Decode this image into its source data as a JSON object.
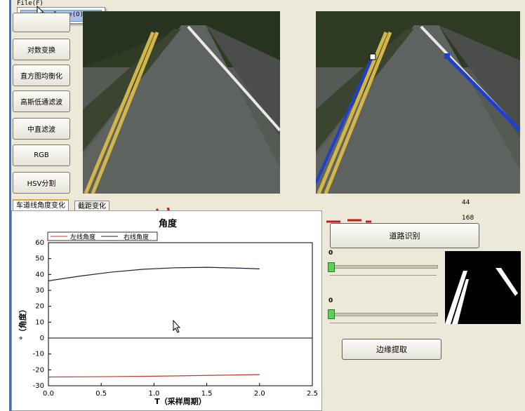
{
  "menu": {
    "file": "File(F)",
    "open_image": "OpenImage(O)"
  },
  "left_buttons": [
    "对数变换",
    "直方图均衡化",
    "高斯低通滤波",
    "中直滤波",
    "RGB",
    "HSV分割"
  ],
  "tabs": [
    "车道线角度变化",
    "截距变化"
  ],
  "labels": {
    "value_a": "44",
    "value_b": "168"
  },
  "buttons": {
    "road_detect": "道路识别",
    "edge_extract": "边缘提取"
  },
  "sliders": [
    {
      "value": "0",
      "level": 0
    },
    {
      "value": "0",
      "level": 0
    }
  ],
  "chart_data": {
    "type": "line",
    "title": "角度",
    "xlabel": "T（采样周期）",
    "ylabel": "°（角度）",
    "xlim": [
      0,
      2.5
    ],
    "ylim": [
      -30,
      60
    ],
    "xticks": [
      "0.0",
      "0.5",
      "1.0",
      "1.5",
      "2.0",
      "2.5"
    ],
    "yticks": [
      "60",
      "50",
      "40",
      "30",
      "20",
      "10",
      "0",
      "-10",
      "-20",
      "-30"
    ],
    "legend_placement": "top-left",
    "series": [
      {
        "name": "左线角度",
        "color": "#c0392b",
        "x": [
          0,
          0.5,
          1.0,
          1.5,
          2.0
        ],
        "y": [
          -24.5,
          -24.3,
          -24.0,
          -23.5,
          -23
        ]
      },
      {
        "name": "右线角度",
        "color": "#2a1840",
        "x": [
          0,
          0.3,
          0.6,
          0.9,
          1.2,
          1.5,
          1.8,
          2.0
        ],
        "y": [
          36,
          39,
          41.5,
          43.3,
          44.2,
          44.5,
          44,
          43.5
        ]
      }
    ]
  }
}
